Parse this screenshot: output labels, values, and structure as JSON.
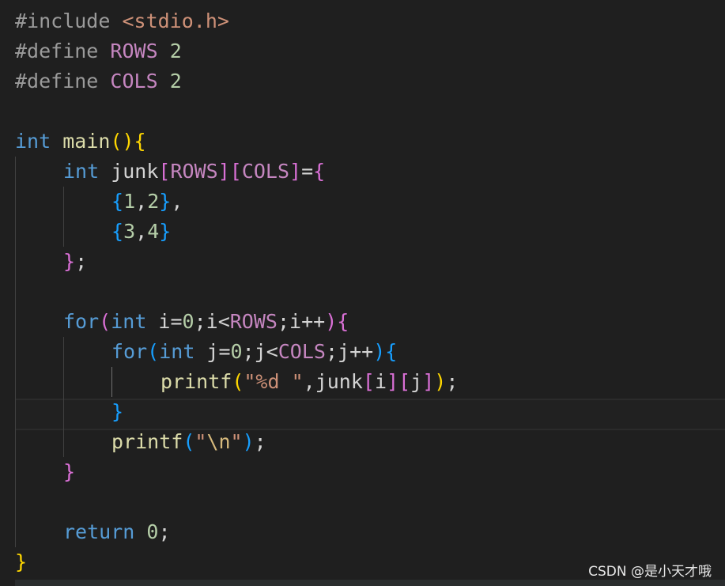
{
  "editor": {
    "lines": [
      {
        "indent": 0,
        "tokens": [
          {
            "text": "#include ",
            "cls": "preproc"
          },
          {
            "text": "<stdio.h>",
            "cls": "str"
          }
        ]
      },
      {
        "indent": 0,
        "tokens": [
          {
            "text": "#define ",
            "cls": "preproc"
          },
          {
            "text": "ROWS",
            "cls": "macro"
          },
          {
            "text": " ",
            "cls": "punc"
          },
          {
            "text": "2",
            "cls": "num"
          }
        ]
      },
      {
        "indent": 0,
        "tokens": [
          {
            "text": "#define ",
            "cls": "preproc"
          },
          {
            "text": "COLS",
            "cls": "macro"
          },
          {
            "text": " ",
            "cls": "punc"
          },
          {
            "text": "2",
            "cls": "num"
          }
        ]
      },
      {
        "indent": 0,
        "tokens": []
      },
      {
        "indent": 0,
        "tokens": [
          {
            "text": "int",
            "cls": "kw-type"
          },
          {
            "text": " ",
            "cls": "punc"
          },
          {
            "text": "main",
            "cls": "func"
          },
          {
            "text": "()",
            "cls": "b1"
          },
          {
            "text": "{",
            "cls": "b1"
          }
        ]
      },
      {
        "indent": 1,
        "tokens": [
          {
            "text": "int",
            "cls": "kw-type"
          },
          {
            "text": " junk",
            "cls": "ident"
          },
          {
            "text": "[",
            "cls": "b2"
          },
          {
            "text": "ROWS",
            "cls": "macro"
          },
          {
            "text": "]",
            "cls": "b2"
          },
          {
            "text": "[",
            "cls": "b2"
          },
          {
            "text": "COLS",
            "cls": "macro"
          },
          {
            "text": "]",
            "cls": "b2"
          },
          {
            "text": "=",
            "cls": "punc"
          },
          {
            "text": "{",
            "cls": "b2"
          }
        ]
      },
      {
        "indent": 2,
        "tokens": [
          {
            "text": "{",
            "cls": "b3"
          },
          {
            "text": "1",
            "cls": "num"
          },
          {
            "text": ",",
            "cls": "punc"
          },
          {
            "text": "2",
            "cls": "num"
          },
          {
            "text": "}",
            "cls": "b3"
          },
          {
            "text": ",",
            "cls": "punc"
          }
        ]
      },
      {
        "indent": 2,
        "tokens": [
          {
            "text": "{",
            "cls": "b3"
          },
          {
            "text": "3",
            "cls": "num"
          },
          {
            "text": ",",
            "cls": "punc"
          },
          {
            "text": "4",
            "cls": "num"
          },
          {
            "text": "}",
            "cls": "b3"
          }
        ]
      },
      {
        "indent": 1,
        "tokens": [
          {
            "text": "}",
            "cls": "b2"
          },
          {
            "text": ";",
            "cls": "punc"
          }
        ]
      },
      {
        "indent": 0,
        "tokens": []
      },
      {
        "indent": 1,
        "tokens": [
          {
            "text": "for",
            "cls": "kw-type"
          },
          {
            "text": "(",
            "cls": "b2"
          },
          {
            "text": "int",
            "cls": "kw-type"
          },
          {
            "text": " i=",
            "cls": "ident"
          },
          {
            "text": "0",
            "cls": "num"
          },
          {
            "text": ";i<",
            "cls": "ident"
          },
          {
            "text": "ROWS",
            "cls": "macro"
          },
          {
            "text": ";i++",
            "cls": "ident"
          },
          {
            "text": ")",
            "cls": "b2"
          },
          {
            "text": "{",
            "cls": "b2"
          }
        ]
      },
      {
        "indent": 2,
        "tokens": [
          {
            "text": "for",
            "cls": "kw-type"
          },
          {
            "text": "(",
            "cls": "b3"
          },
          {
            "text": "int",
            "cls": "kw-type"
          },
          {
            "text": " j=",
            "cls": "ident"
          },
          {
            "text": "0",
            "cls": "num"
          },
          {
            "text": ";j<",
            "cls": "ident"
          },
          {
            "text": "COLS",
            "cls": "macro"
          },
          {
            "text": ";j++",
            "cls": "ident"
          },
          {
            "text": ")",
            "cls": "b3"
          },
          {
            "text": "{",
            "cls": "b3"
          }
        ]
      },
      {
        "indent": 3,
        "tokens": [
          {
            "text": "printf",
            "cls": "func"
          },
          {
            "text": "(",
            "cls": "b1"
          },
          {
            "text": "\"%d \"",
            "cls": "str"
          },
          {
            "text": ",junk",
            "cls": "ident"
          },
          {
            "text": "[",
            "cls": "b2"
          },
          {
            "text": "i",
            "cls": "ident"
          },
          {
            "text": "]",
            "cls": "b2"
          },
          {
            "text": "[",
            "cls": "b2"
          },
          {
            "text": "j",
            "cls": "ident"
          },
          {
            "text": "]",
            "cls": "b2"
          },
          {
            "text": ")",
            "cls": "b1"
          },
          {
            "text": ";",
            "cls": "punc"
          }
        ]
      },
      {
        "indent": 2,
        "tokens": [
          {
            "text": "}",
            "cls": "b3"
          }
        ]
      },
      {
        "indent": 2,
        "tokens": [
          {
            "text": "printf",
            "cls": "func"
          },
          {
            "text": "(",
            "cls": "b3"
          },
          {
            "text": "\"",
            "cls": "str"
          },
          {
            "text": "\\n",
            "cls": "esc"
          },
          {
            "text": "\"",
            "cls": "str"
          },
          {
            "text": ")",
            "cls": "b3"
          },
          {
            "text": ";",
            "cls": "punc"
          }
        ]
      },
      {
        "indent": 1,
        "tokens": [
          {
            "text": "}",
            "cls": "b2"
          }
        ]
      },
      {
        "indent": 0,
        "tokens": []
      },
      {
        "indent": 1,
        "tokens": [
          {
            "text": "return",
            "cls": "kw-return"
          },
          {
            "text": " ",
            "cls": "punc"
          },
          {
            "text": "0",
            "cls": "num"
          },
          {
            "text": ";",
            "cls": "punc"
          }
        ]
      },
      {
        "indent": 0,
        "tokens": [
          {
            "text": "}",
            "cls": "b1"
          }
        ]
      }
    ]
  },
  "watermark": {
    "text": "CSDN @是小天才哦"
  },
  "colors": {
    "background": "#1f1f1f",
    "keyword": "#569cd6",
    "macro": "#c586c0",
    "function": "#dcdcaa",
    "string": "#ce9178",
    "number": "#b5cea8",
    "bracket_level1": "#ffd700",
    "bracket_level2": "#da70d6",
    "bracket_level3": "#179fff"
  }
}
